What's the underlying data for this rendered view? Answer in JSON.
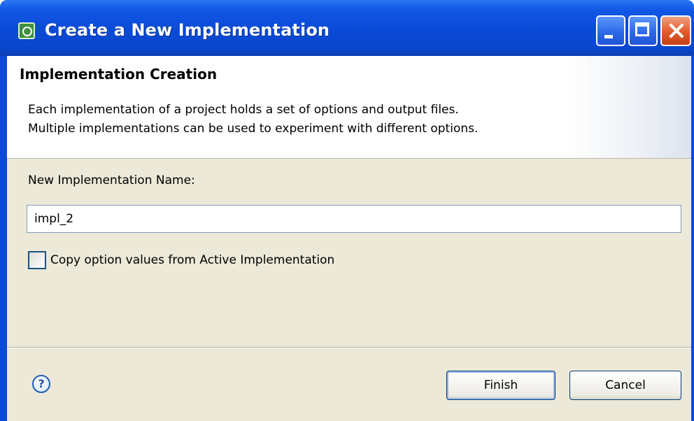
{
  "window": {
    "title": "Create a New Implementation"
  },
  "header": {
    "title": "Implementation Creation",
    "description_line1": "Each implementation of a project holds a set of options and output files.",
    "description_line2": "Multiple implementations can be used to experiment with different options."
  },
  "form": {
    "name_label": "New Implementation Name:",
    "name_value": "impl_2",
    "copy_option_label": "Copy option values from Active Implementation",
    "copy_option_checked": false
  },
  "footer": {
    "help_glyph": "?",
    "finish_label": "Finish",
    "cancel_label": "Cancel"
  },
  "icons": {
    "app": "eclipse-app-icon",
    "minimize": "minimize-icon",
    "maximize": "maximize-icon",
    "close": "close-icon",
    "help": "help-icon"
  },
  "colors": {
    "titlebar": "#0a4ad6",
    "dialog_bg": "#ece9d8",
    "close_button": "#e25a2a"
  }
}
